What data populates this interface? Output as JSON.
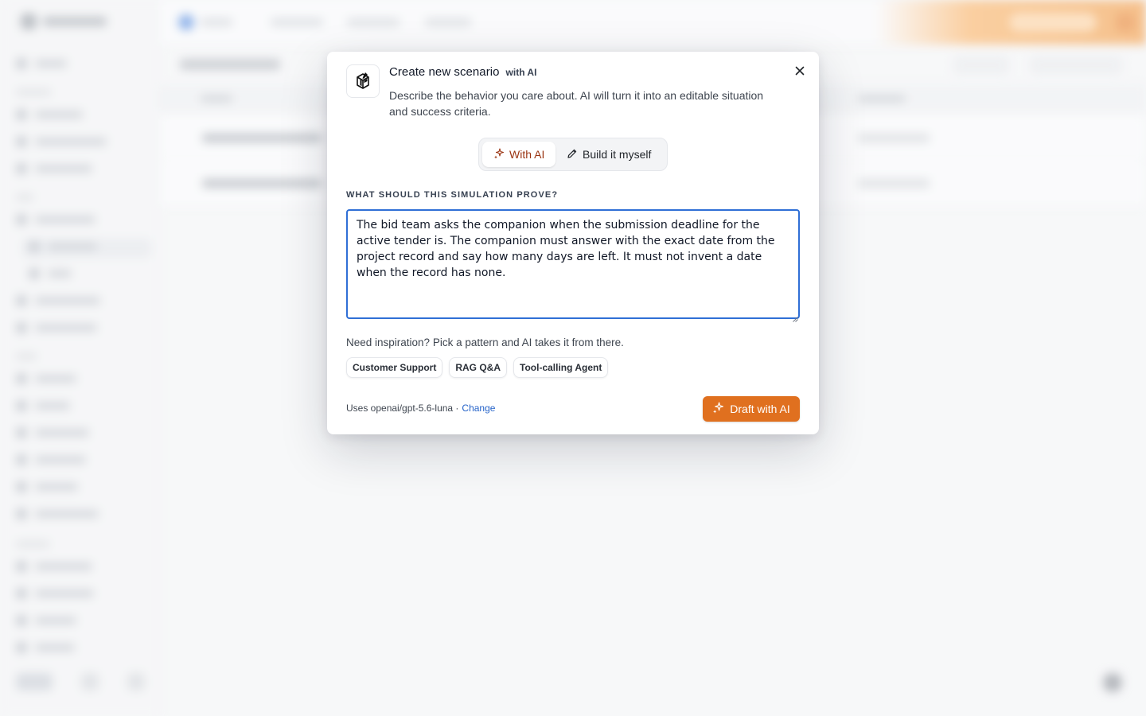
{
  "modal": {
    "title": "Create new scenario",
    "badge": "with AI",
    "description": "Describe the behavior you care about. AI will turn it into an editable situation and success criteria.",
    "segmented": {
      "with_ai": "With AI",
      "build_myself": "Build it myself"
    },
    "prompt_label": "WHAT SHOULD THIS SIMULATION PROVE?",
    "prompt_value": "The bid team asks the companion when the submission deadline for the active tender is. The companion must answer with the exact date from the project record and say how many days are left. It must not invent a date when the record has none.",
    "inspiration": "Need inspiration? Pick a pattern and AI takes it from there.",
    "chips": [
      "Customer Support",
      "RAG Q&A",
      "Tool-calling Agent"
    ],
    "model_prefix": "Uses openai/gpt-5.6-luna ·",
    "change_label": "Change",
    "draft_label": "Draft with AI"
  },
  "icons": {
    "scenario": "cube-pen-icon",
    "close": "close-icon",
    "ai": "sparkles-icon",
    "build": "pencil-icon"
  },
  "colors": {
    "accent_orange": "#e0701f",
    "focus_blue": "#2f6fd6",
    "link_blue": "#2563c9"
  }
}
